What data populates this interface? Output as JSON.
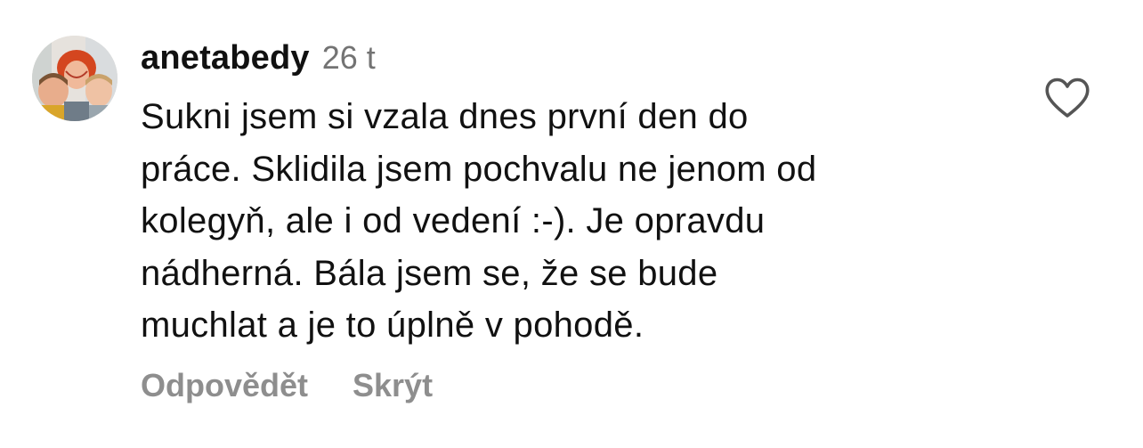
{
  "comment": {
    "username": "anetabedy",
    "time": "26 t",
    "text_lines": [
      "Sukni jsem si vzala dnes první den do",
      "práce. Sklidila jsem pochvalu ne jenom od",
      "kolegyň, ale i od vedení :-). Je opravdu",
      "nádherná. Bála jsem se, že se bude",
      "muchlat a je to úplně v pohodě."
    ],
    "reply_label": "Odpovědět",
    "hide_label": "Skrýt",
    "avatar_icon": "profile-photo",
    "like_icon": "heart-outline-icon"
  },
  "colors": {
    "text": "#111111",
    "muted": "#737373",
    "action": "#8e8e8e",
    "icon": "#555555"
  }
}
